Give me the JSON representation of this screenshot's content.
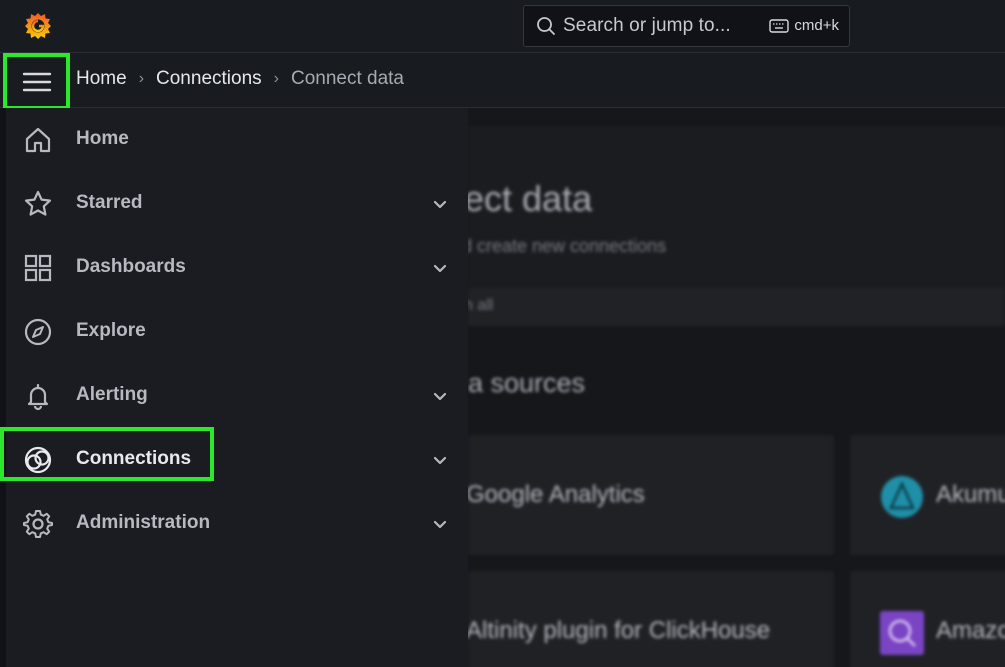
{
  "topbar": {
    "logo_icon": "grafana-logo-icon",
    "search": {
      "placeholder": "Search or jump to...",
      "icon": "search-icon",
      "shortcut": "cmd+k",
      "shortcut_icon": "keyboard-icon"
    }
  },
  "breadcrumb": {
    "menu_icon": "hamburger-menu-icon",
    "items": [
      "Home",
      "Connections",
      "Connect data"
    ],
    "separator": "›"
  },
  "sidebar": {
    "items": [
      {
        "label": "Home",
        "icon": "home-icon",
        "expandable": false
      },
      {
        "label": "Starred",
        "icon": "star-icon",
        "expandable": true
      },
      {
        "label": "Dashboards",
        "icon": "dashboards-grid-icon",
        "expandable": true
      },
      {
        "label": "Explore",
        "icon": "compass-icon",
        "expandable": false
      },
      {
        "label": "Alerting",
        "icon": "bell-icon",
        "expandable": true
      },
      {
        "label": "Connections",
        "icon": "connections-icon",
        "expandable": true,
        "highlighted": true
      },
      {
        "label": "Administration",
        "icon": "gear-icon",
        "expandable": true
      }
    ]
  },
  "main": {
    "title_fragment": "ect data",
    "subtitle_fragment": "d create new connections",
    "search_fragment": "h all",
    "section_fragment": "a sources",
    "cards": [
      {
        "label": "Google Analytics"
      },
      {
        "label": "Akumu"
      },
      {
        "label": "Altinity plugin for ClickHouse"
      },
      {
        "label": "Amazo"
      }
    ]
  },
  "colors": {
    "highlight": "#2ce82c",
    "sidebar_bg": "#1a1c21",
    "topbar_bg": "#181b1f",
    "grafana_orange": "#f05a28"
  }
}
